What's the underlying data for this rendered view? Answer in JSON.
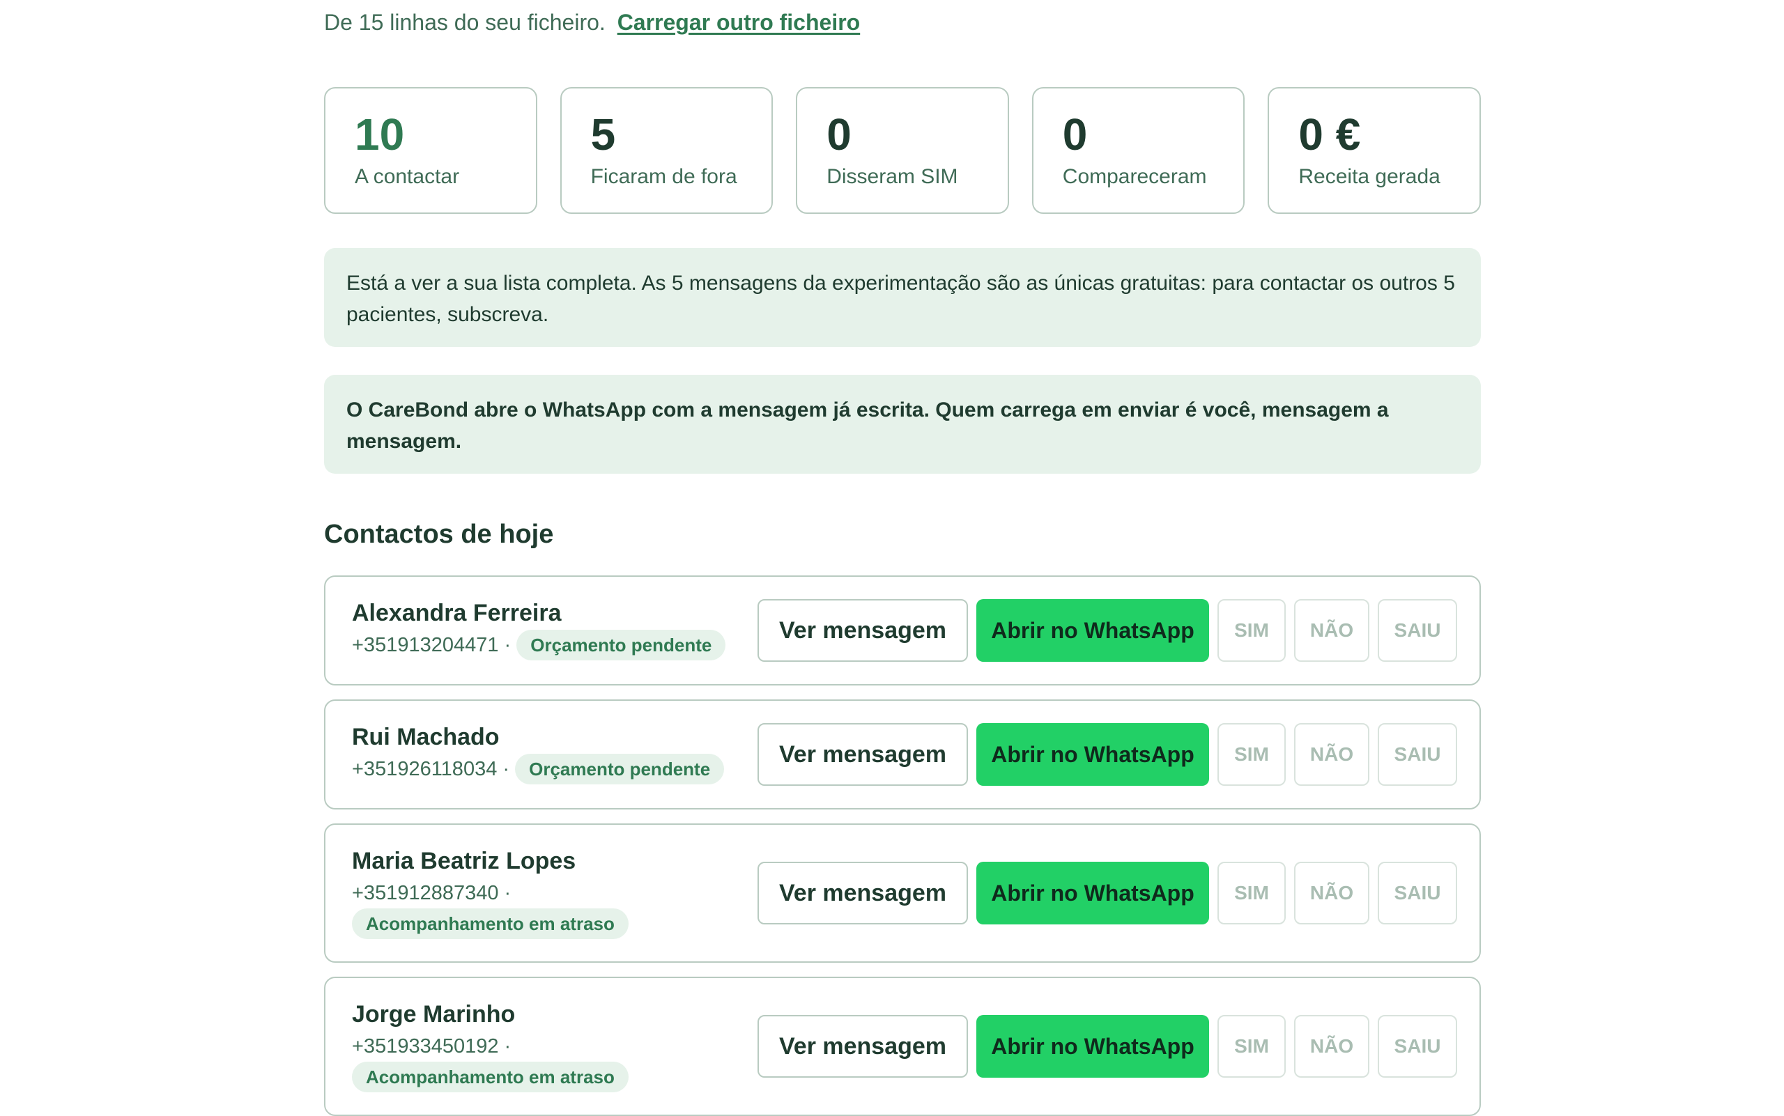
{
  "intro": {
    "text": "De 15 linhas do seu ficheiro.",
    "link": "Carregar outro ficheiro"
  },
  "stats": [
    {
      "value": "10",
      "label": "A contactar"
    },
    {
      "value": "5",
      "label": "Ficaram de fora"
    },
    {
      "value": "0",
      "label": "Disseram SIM"
    },
    {
      "value": "0",
      "label": "Compareceram"
    },
    {
      "value": "0 €",
      "label": "Receita gerada"
    }
  ],
  "notices": [
    "Está a ver a sua lista completa. As 5 mensagens da experimentação são as únicas gratuitas: para contactar os outros 5 pacientes, subscreva.",
    "O CareBond abre o WhatsApp com a mensagem já escrita. Quem carrega em enviar é você, mensagem a mensagem."
  ],
  "section_title": "Contactos de hoje",
  "actions": {
    "view": "Ver mensagem",
    "whatsapp": "Abrir no WhatsApp",
    "sim": "SIM",
    "nao": "NÃO",
    "saiu": "SAIU"
  },
  "contacts": [
    {
      "name": "Alexandra Ferreira",
      "phone": "+351913204471 ·",
      "status": "Orçamento pendente"
    },
    {
      "name": "Rui Machado",
      "phone": "+351926118034 ·",
      "status": "Orçamento pendente"
    },
    {
      "name": "Maria Beatriz Lopes",
      "phone": "+351912887340 ·",
      "status": "Acompanhamento em atraso"
    },
    {
      "name": "Jorge Marinho",
      "phone": "+351933450192 ·",
      "status": "Acompanhamento em atraso"
    }
  ],
  "colors": {
    "accent": "#2f7a52",
    "whatsapp": "#22d066",
    "notice_bg": "#e6f2ea",
    "border": "#b9cbc1"
  }
}
